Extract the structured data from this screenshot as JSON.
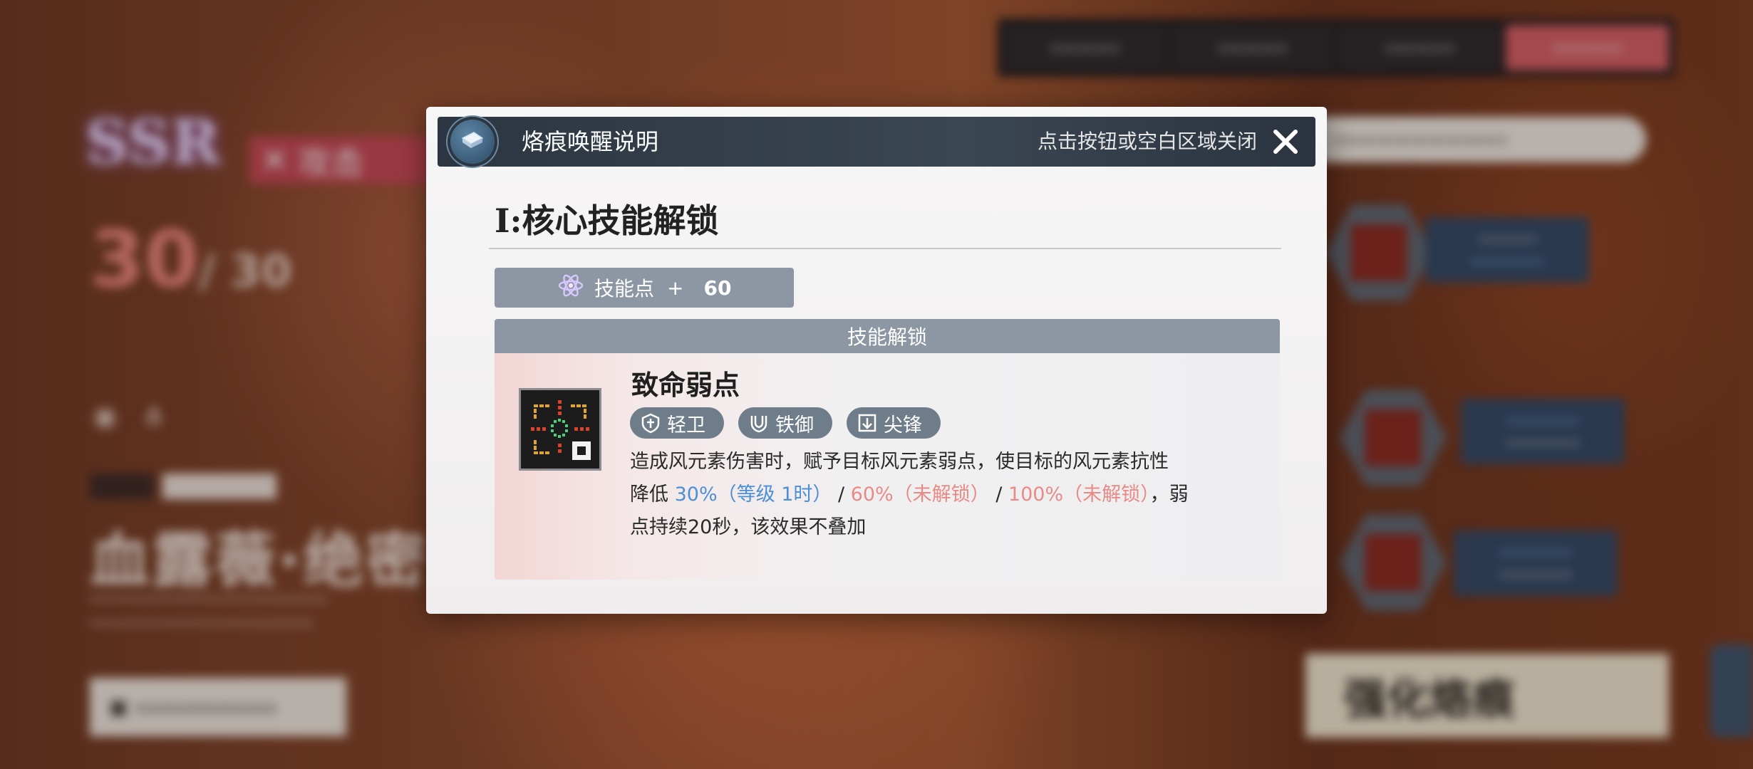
{
  "modal": {
    "title": "烙痕唤醒说明",
    "close_hint": "点击按钮或空白区域关闭",
    "section_title": "I:核心技能解锁",
    "skill_points": {
      "label": "技能点",
      "plus": "+",
      "value": "60"
    },
    "unlock_header": "技能解锁",
    "skill": {
      "name": "致命弱点",
      "tags": [
        "轻卫",
        "铁御",
        "尖锋"
      ],
      "desc_line1": "造成风元素伤害时，赋予目标风元素弱点，使目标的风元素抗性",
      "desc_prefix": "降低 ",
      "level1": "30%（等级 1时）",
      "sep1": " / ",
      "level2": "60%（未解锁）",
      "sep2": " / ",
      "level3": "100%（未解锁）",
      "desc_suffix": "，弱",
      "desc_line3": "点持续20秒，该效果不叠加"
    }
  },
  "background": {
    "rarity": "SSR",
    "level_current": "30",
    "level_max": "/ 30",
    "attack_label": "攻击",
    "character_name": "血露薇·绝密",
    "enhance_label": "强化烙痕"
  },
  "colors": {
    "accent_blue": "#4c8fd6",
    "locked_red": "#e98a86",
    "tab_active": "#d9626a",
    "tag_bg": "#6f7c89",
    "bar_bg": "#8d97a3"
  }
}
